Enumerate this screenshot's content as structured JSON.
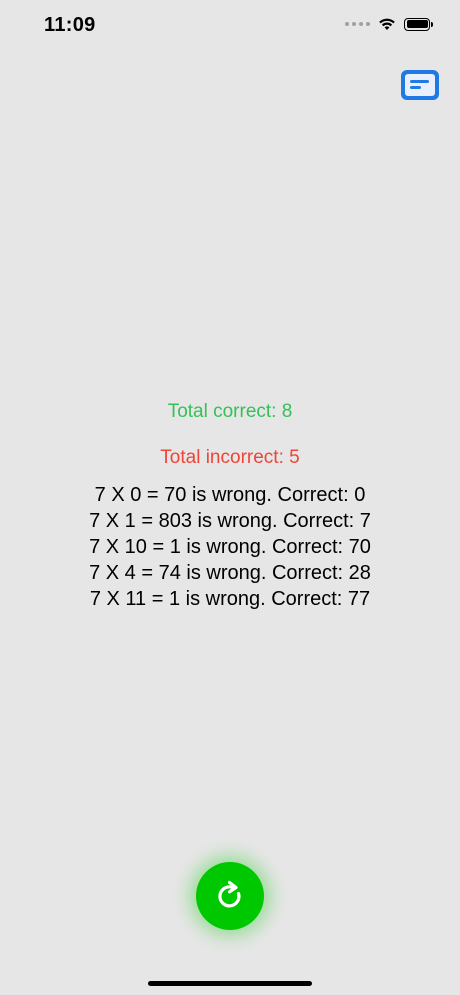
{
  "status_bar": {
    "time": "11:09",
    "icons": [
      "signal-icon",
      "wifi-icon",
      "battery-icon"
    ]
  },
  "toolbar": {
    "report_icon": "report-icon",
    "accent_color": "#1f7be3"
  },
  "results": {
    "total_correct": "Total correct: 8",
    "total_incorrect": "Total incorrect: 5",
    "mistakes": [
      "7 X 0 = 70 is wrong. Correct: 0",
      "7 X 1 = 803 is wrong. Correct: 7",
      "7 X 10 = 1 is wrong. Correct: 70",
      "7 X 4 = 74 is wrong. Correct: 28",
      "7 X 11 = 1 is wrong. Correct: 77"
    ],
    "correct_color": "#34c159",
    "incorrect_color": "#ef4438"
  },
  "restart": {
    "icon": "restart-icon",
    "color": "#00c800"
  }
}
